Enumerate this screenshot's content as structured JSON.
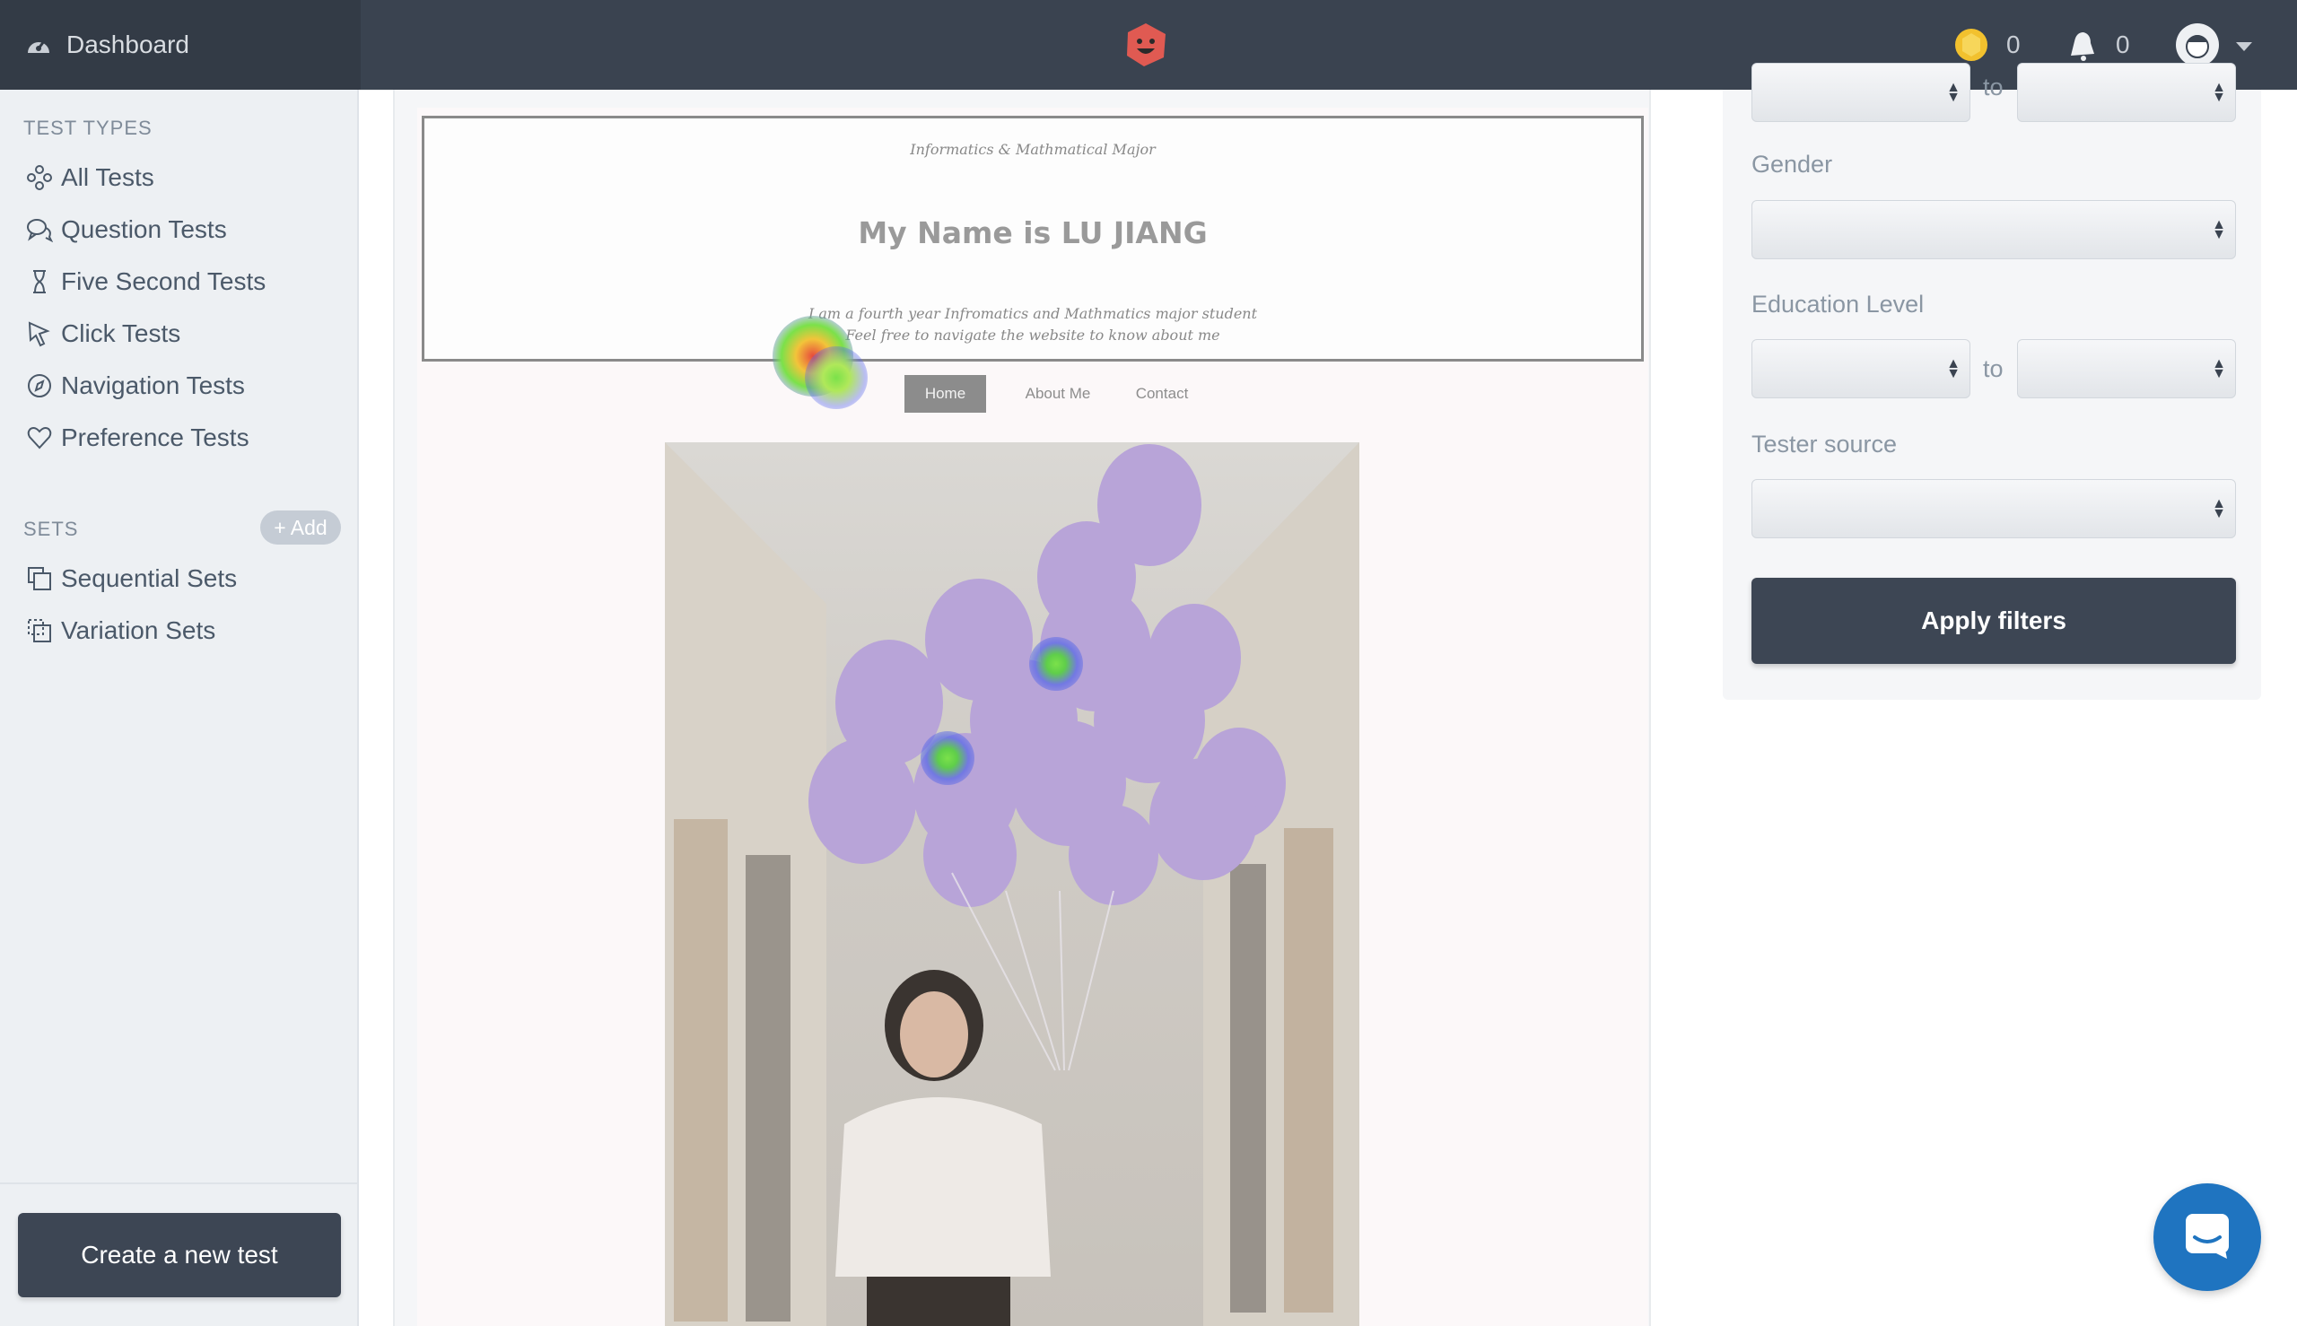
{
  "topbar": {
    "dashboard_label": "Dashboard",
    "coins_count": "0",
    "notifications_count": "0"
  },
  "sidebar": {
    "test_types_heading": "TEST TYPES",
    "items": [
      {
        "label": "All Tests",
        "icon": "nodes-icon"
      },
      {
        "label": "Question Tests",
        "icon": "chat-bubbles-icon"
      },
      {
        "label": "Five Second Tests",
        "icon": "hourglass-icon"
      },
      {
        "label": "Click Tests",
        "icon": "cursor-icon"
      },
      {
        "label": "Navigation Tests",
        "icon": "compass-icon"
      },
      {
        "label": "Preference Tests",
        "icon": "heart-icon"
      }
    ],
    "sets_heading": "SETS",
    "add_label": "+ Add",
    "sets": [
      {
        "label": "Sequential Sets",
        "icon": "stacked-squares-icon"
      },
      {
        "label": "Variation Sets",
        "icon": "dashed-squares-icon"
      }
    ],
    "create_button": "Create a new test"
  },
  "screenshot": {
    "hero_subtitle": "Informatics & Mathmatical Major",
    "hero_title": "My Name is LU JIANG",
    "hero_line1": "I am a fourth year Infromatics and Mathmatics major student",
    "hero_line2": "Feel free to navigate the website to know about me",
    "nav": [
      "Home",
      "About Me",
      "Contact"
    ]
  },
  "filters": {
    "gender_label": "Gender",
    "education_label": "Education Level",
    "to_label": "to",
    "tester_source_label": "Tester source",
    "apply_button": "Apply filters"
  },
  "colors": {
    "topbar": "#3a4350",
    "sidebar": "#edf0f3",
    "primary_button": "#3d4654",
    "chat_bubble": "#1f74c0",
    "heat_hot": "#e84a3c",
    "heat_mid": "#7be14a",
    "heat_cool": "#5566e8"
  }
}
